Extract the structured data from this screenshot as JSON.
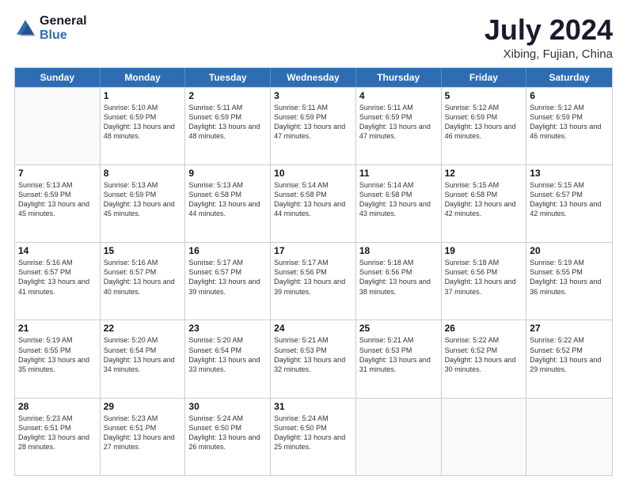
{
  "logo": {
    "line1": "General",
    "line2": "Blue"
  },
  "title": "July 2024",
  "location": "Xibing, Fujian, China",
  "header_days": [
    "Sunday",
    "Monday",
    "Tuesday",
    "Wednesday",
    "Thursday",
    "Friday",
    "Saturday"
  ],
  "weeks": [
    [
      {
        "day": "",
        "sunrise": "",
        "sunset": "",
        "daylight": ""
      },
      {
        "day": "1",
        "sunrise": "Sunrise: 5:10 AM",
        "sunset": "Sunset: 6:59 PM",
        "daylight": "Daylight: 13 hours and 48 minutes."
      },
      {
        "day": "2",
        "sunrise": "Sunrise: 5:11 AM",
        "sunset": "Sunset: 6:59 PM",
        "daylight": "Daylight: 13 hours and 48 minutes."
      },
      {
        "day": "3",
        "sunrise": "Sunrise: 5:11 AM",
        "sunset": "Sunset: 6:59 PM",
        "daylight": "Daylight: 13 hours and 47 minutes."
      },
      {
        "day": "4",
        "sunrise": "Sunrise: 5:11 AM",
        "sunset": "Sunset: 6:59 PM",
        "daylight": "Daylight: 13 hours and 47 minutes."
      },
      {
        "day": "5",
        "sunrise": "Sunrise: 5:12 AM",
        "sunset": "Sunset: 6:59 PM",
        "daylight": "Daylight: 13 hours and 46 minutes."
      },
      {
        "day": "6",
        "sunrise": "Sunrise: 5:12 AM",
        "sunset": "Sunset: 6:59 PM",
        "daylight": "Daylight: 13 hours and 46 minutes."
      }
    ],
    [
      {
        "day": "7",
        "sunrise": "Sunrise: 5:13 AM",
        "sunset": "Sunset: 6:59 PM",
        "daylight": "Daylight: 13 hours and 45 minutes."
      },
      {
        "day": "8",
        "sunrise": "Sunrise: 5:13 AM",
        "sunset": "Sunset: 6:59 PM",
        "daylight": "Daylight: 13 hours and 45 minutes."
      },
      {
        "day": "9",
        "sunrise": "Sunrise: 5:13 AM",
        "sunset": "Sunset: 6:58 PM",
        "daylight": "Daylight: 13 hours and 44 minutes."
      },
      {
        "day": "10",
        "sunrise": "Sunrise: 5:14 AM",
        "sunset": "Sunset: 6:58 PM",
        "daylight": "Daylight: 13 hours and 44 minutes."
      },
      {
        "day": "11",
        "sunrise": "Sunrise: 5:14 AM",
        "sunset": "Sunset: 6:58 PM",
        "daylight": "Daylight: 13 hours and 43 minutes."
      },
      {
        "day": "12",
        "sunrise": "Sunrise: 5:15 AM",
        "sunset": "Sunset: 6:58 PM",
        "daylight": "Daylight: 13 hours and 42 minutes."
      },
      {
        "day": "13",
        "sunrise": "Sunrise: 5:15 AM",
        "sunset": "Sunset: 6:57 PM",
        "daylight": "Daylight: 13 hours and 42 minutes."
      }
    ],
    [
      {
        "day": "14",
        "sunrise": "Sunrise: 5:16 AM",
        "sunset": "Sunset: 6:57 PM",
        "daylight": "Daylight: 13 hours and 41 minutes."
      },
      {
        "day": "15",
        "sunrise": "Sunrise: 5:16 AM",
        "sunset": "Sunset: 6:57 PM",
        "daylight": "Daylight: 13 hours and 40 minutes."
      },
      {
        "day": "16",
        "sunrise": "Sunrise: 5:17 AM",
        "sunset": "Sunset: 6:57 PM",
        "daylight": "Daylight: 13 hours and 39 minutes."
      },
      {
        "day": "17",
        "sunrise": "Sunrise: 5:17 AM",
        "sunset": "Sunset: 6:56 PM",
        "daylight": "Daylight: 13 hours and 39 minutes."
      },
      {
        "day": "18",
        "sunrise": "Sunrise: 5:18 AM",
        "sunset": "Sunset: 6:56 PM",
        "daylight": "Daylight: 13 hours and 38 minutes."
      },
      {
        "day": "19",
        "sunrise": "Sunrise: 5:18 AM",
        "sunset": "Sunset: 6:56 PM",
        "daylight": "Daylight: 13 hours and 37 minutes."
      },
      {
        "day": "20",
        "sunrise": "Sunrise: 5:19 AM",
        "sunset": "Sunset: 6:55 PM",
        "daylight": "Daylight: 13 hours and 36 minutes."
      }
    ],
    [
      {
        "day": "21",
        "sunrise": "Sunrise: 5:19 AM",
        "sunset": "Sunset: 6:55 PM",
        "daylight": "Daylight: 13 hours and 35 minutes."
      },
      {
        "day": "22",
        "sunrise": "Sunrise: 5:20 AM",
        "sunset": "Sunset: 6:54 PM",
        "daylight": "Daylight: 13 hours and 34 minutes."
      },
      {
        "day": "23",
        "sunrise": "Sunrise: 5:20 AM",
        "sunset": "Sunset: 6:54 PM",
        "daylight": "Daylight: 13 hours and 33 minutes."
      },
      {
        "day": "24",
        "sunrise": "Sunrise: 5:21 AM",
        "sunset": "Sunset: 6:53 PM",
        "daylight": "Daylight: 13 hours and 32 minutes."
      },
      {
        "day": "25",
        "sunrise": "Sunrise: 5:21 AM",
        "sunset": "Sunset: 6:53 PM",
        "daylight": "Daylight: 13 hours and 31 minutes."
      },
      {
        "day": "26",
        "sunrise": "Sunrise: 5:22 AM",
        "sunset": "Sunset: 6:52 PM",
        "daylight": "Daylight: 13 hours and 30 minutes."
      },
      {
        "day": "27",
        "sunrise": "Sunrise: 5:22 AM",
        "sunset": "Sunset: 6:52 PM",
        "daylight": "Daylight: 13 hours and 29 minutes."
      }
    ],
    [
      {
        "day": "28",
        "sunrise": "Sunrise: 5:23 AM",
        "sunset": "Sunset: 6:51 PM",
        "daylight": "Daylight: 13 hours and 28 minutes."
      },
      {
        "day": "29",
        "sunrise": "Sunrise: 5:23 AM",
        "sunset": "Sunset: 6:51 PM",
        "daylight": "Daylight: 13 hours and 27 minutes."
      },
      {
        "day": "30",
        "sunrise": "Sunrise: 5:24 AM",
        "sunset": "Sunset: 6:50 PM",
        "daylight": "Daylight: 13 hours and 26 minutes."
      },
      {
        "day": "31",
        "sunrise": "Sunrise: 5:24 AM",
        "sunset": "Sunset: 6:50 PM",
        "daylight": "Daylight: 13 hours and 25 minutes."
      },
      {
        "day": "",
        "sunrise": "",
        "sunset": "",
        "daylight": ""
      },
      {
        "day": "",
        "sunrise": "",
        "sunset": "",
        "daylight": ""
      },
      {
        "day": "",
        "sunrise": "",
        "sunset": "",
        "daylight": ""
      }
    ]
  ]
}
